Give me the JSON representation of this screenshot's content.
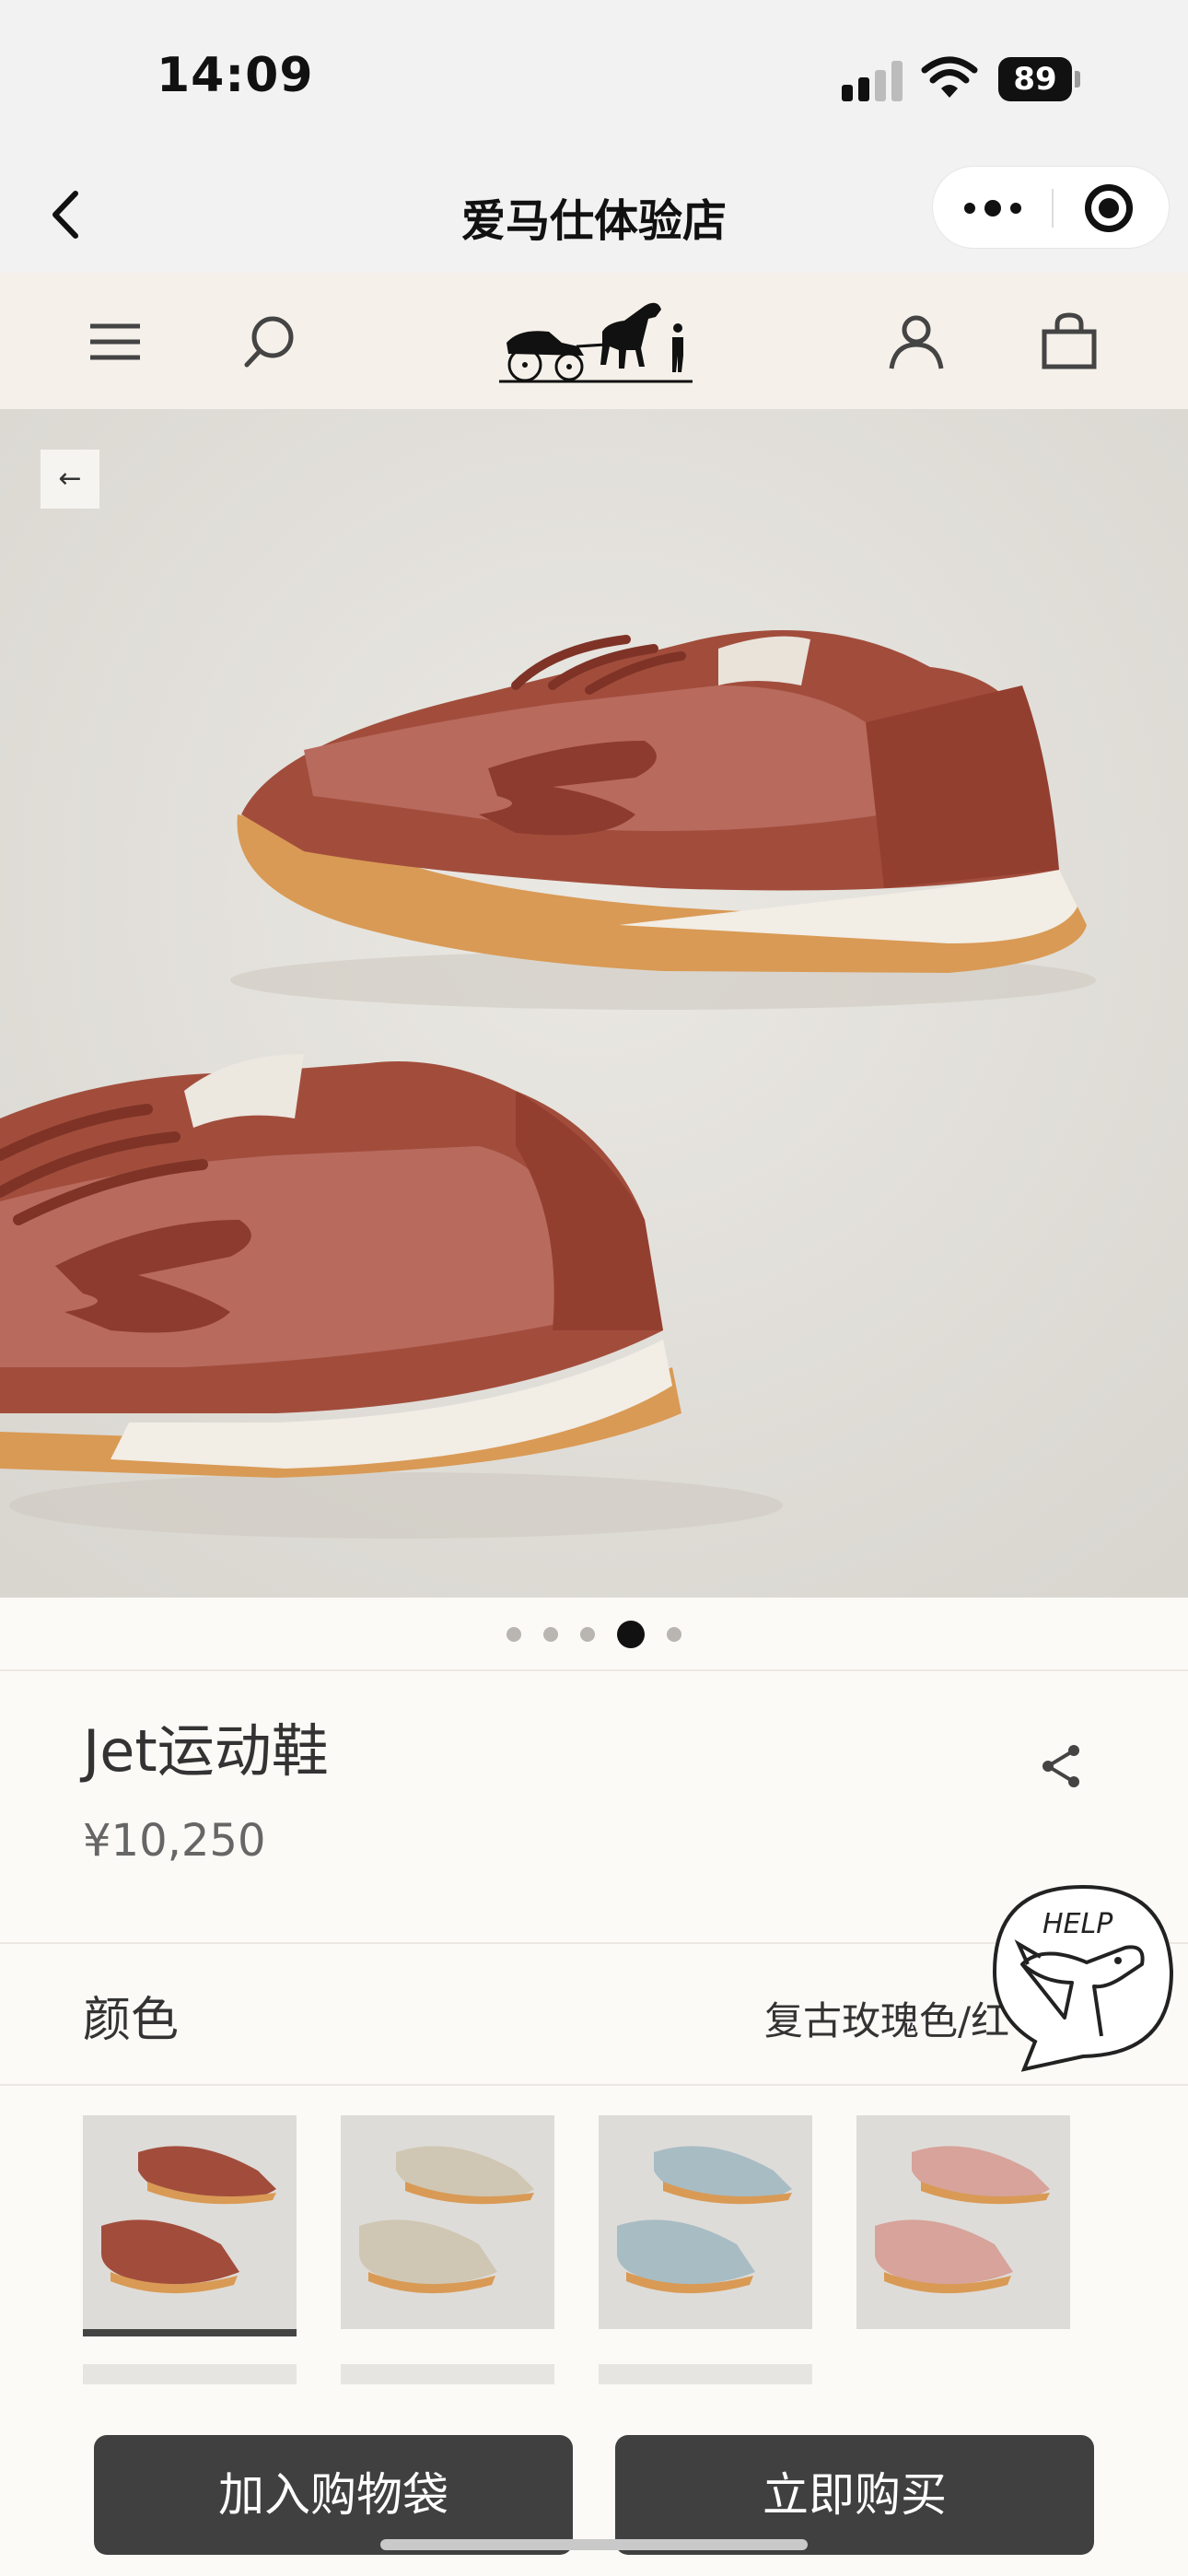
{
  "status_bar": {
    "time": "14:09",
    "battery": "89"
  },
  "mini_program": {
    "title": "爱马仕体验店"
  },
  "product": {
    "name": "Jet运动鞋",
    "price": "¥10,250",
    "image_count": 5,
    "active_image_index": 3
  },
  "color": {
    "label": "颜色",
    "value": "复古玫瑰色/红"
  },
  "swatches": [
    {
      "color": "rust red",
      "selected": true
    },
    {
      "color": "beige",
      "selected": false
    },
    {
      "color": "light blue",
      "selected": false
    },
    {
      "color": "pink",
      "selected": false
    }
  ],
  "help": {
    "label": "HELP"
  },
  "actions": {
    "add_to_bag": "加入购物袋",
    "buy_now": "立即购买"
  },
  "icons": [
    "back-icon",
    "more-icon",
    "close-icon",
    "menu-icon",
    "search-icon",
    "logo",
    "account-icon",
    "bag-icon",
    "share-icon",
    "help-icon"
  ],
  "colors": {
    "button": "#404040",
    "page_bg": "#fcfaf6",
    "header_bg": "#f5f1ea"
  }
}
